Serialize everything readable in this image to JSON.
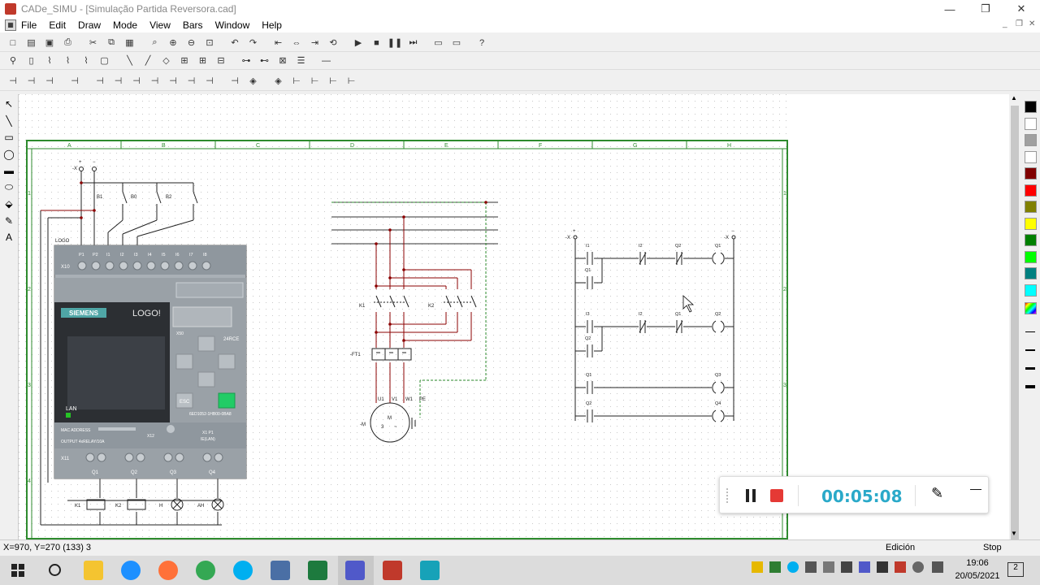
{
  "window": {
    "app": "CADe_SIMU",
    "title": "CADe_SIMU - [Simulação Partida Reversora.cad]"
  },
  "window_controls": {
    "minimize": "—",
    "maximize": "❐",
    "close": "✕"
  },
  "menu": [
    "File",
    "Edit",
    "Draw",
    "Mode",
    "View",
    "Bars",
    "Window",
    "Help"
  ],
  "mdi_controls": {
    "minimize": "_",
    "restore": "❐",
    "close": "✕"
  },
  "toolbar1": [
    "new-icon",
    "open-icon",
    "save-icon",
    "print-icon",
    "cut-icon",
    "copy-icon",
    "paste-icon",
    "zoom-icon",
    "zoom-in-icon",
    "zoom-out-icon",
    "zoom-area-icon",
    "undo-icon",
    "redo-icon",
    "align-left-icon",
    "align-center-icon",
    "align-right-icon",
    "rotate-icon",
    "play-icon",
    "stop-icon",
    "pause-icon",
    "step-icon",
    "window-icon",
    "window2-icon",
    "help-icon"
  ],
  "toolbar1_glyphs": [
    "□",
    "▤",
    "▣",
    "⎙",
    "✂",
    "⧉",
    "▦",
    "⌕",
    "⊕",
    "⊖",
    "⊡",
    "↶",
    "↷",
    "⇤",
    "⇔",
    "⇥",
    "⟲",
    "▶",
    "■",
    "❚❚",
    "⏭",
    "▭",
    "▭",
    "?"
  ],
  "toolbar2_glyphs": [
    "⚲",
    "▯",
    "⌇",
    "⌇",
    "⌇",
    "▢",
    "╲",
    "╱",
    "◇",
    "⊞",
    "⊞",
    "⊟",
    "⊶",
    "⊷",
    "⊠",
    "☰",
    "—"
  ],
  "toolbar3_glyphs": [
    "⊣",
    "⊣",
    "⊣",
    "⊣",
    "⊣",
    "⊣",
    "⊣",
    "⊣",
    "⊣",
    "⊣",
    "⊣",
    "⊣",
    "◈",
    "◈",
    "⊢",
    "⊢",
    "⊢",
    "⊢"
  ],
  "left_tools": [
    "↖",
    "╲",
    "▭",
    "◯",
    "▬",
    "⬭",
    "⬙",
    "✎",
    "A"
  ],
  "palette_colors": [
    "#000000",
    "#ffffff",
    "#a0a0a0",
    "#ffffff",
    "#800000",
    "#ff0000",
    "#808000",
    "#ffff00",
    "#008000",
    "#00ff00",
    "#008080",
    "#00ffff"
  ],
  "status": {
    "coords": "X=970, Y=270 (133) 3",
    "mode": "Edición",
    "run": "Stop"
  },
  "recorder": {
    "timer": "00:05:08"
  },
  "clock": {
    "time": "19:06",
    "date": "20/05/2021",
    "notifications": "2"
  },
  "sheet": {
    "columns": [
      "A",
      "B",
      "C",
      "D",
      "E",
      "F",
      "G",
      "H"
    ],
    "rows": [
      "1",
      "2",
      "3",
      "4"
    ]
  },
  "logo": {
    "brand": "SIEMENS",
    "model": "LOGO!",
    "tag": "LOGO",
    "inputs_label": "X10",
    "inputs": [
      "P1",
      "P2",
      "I1",
      "I2",
      "I3",
      "I4",
      "I5",
      "I6",
      "I7",
      "I8"
    ],
    "part_no": "6ED1052-1HB00-0BA8",
    "variant": "24RCE",
    "port": "X50",
    "lan": "LAN",
    "mac": "MAC ADDRESS",
    "output": "OUTPUT 4xRELAY/10A",
    "x12": "X12",
    "x1p1": "X1 P1",
    "ie_lan": "IE(LAN)",
    "outputs_label": "X11",
    "outputs": [
      "Q1",
      "Q2",
      "Q3",
      "Q4"
    ],
    "esc": "ESC"
  },
  "control_labels": {
    "buttons": [
      "B1",
      "B0",
      "B2"
    ],
    "coils": [
      "K1",
      "K2",
      "H",
      "AH"
    ]
  },
  "power_labels": {
    "contactors": [
      "K1",
      "K2"
    ],
    "relay": "-FT1",
    "motor": "-M",
    "terminals": [
      "U1",
      "V1",
      "W1",
      "PE"
    ]
  },
  "ladder": {
    "rungs": [
      {
        "contacts": [
          "I1",
          "I2",
          "Q2"
        ],
        "coil": "Q1",
        "hold": "Q1"
      },
      {
        "contacts": [
          "I3",
          "I2",
          "Q1"
        ],
        "coil": "Q2",
        "hold": "Q2"
      },
      {
        "contacts": [
          "Q1"
        ],
        "coil": "Q3"
      },
      {
        "contacts": [
          "Q2"
        ],
        "coil": "Q4"
      }
    ]
  }
}
